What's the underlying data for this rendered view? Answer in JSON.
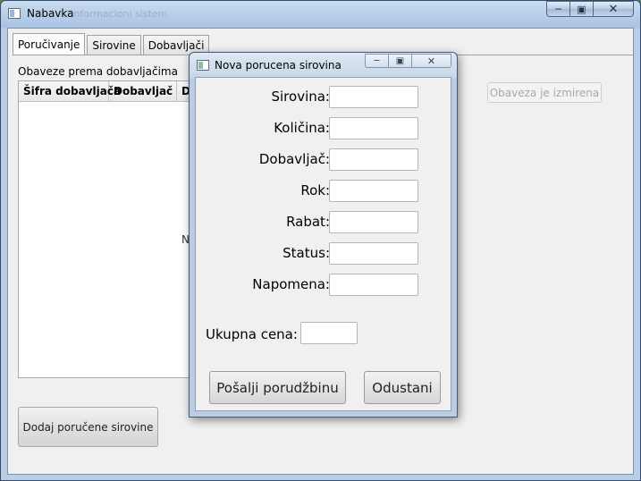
{
  "main_window": {
    "title": "Nabavka",
    "title_ghost": "Informacioni sistem"
  },
  "tabs": [
    {
      "label": "Poručivanje",
      "active": true
    },
    {
      "label": "Sirovine",
      "active": false
    },
    {
      "label": "Dobavljači",
      "active": false
    }
  ],
  "orders_tab": {
    "section_label": "Obaveze prema dobavljačima",
    "table_headers": [
      "Šifra dobavljača",
      "Dobavljač",
      "Da"
    ],
    "table_placeholder": "N",
    "changed_button": "Obaveza je izmirena",
    "add_button": "Dodaj poručene sirovine"
  },
  "dialog": {
    "title": "Nova porucena sirovina",
    "fields": [
      {
        "label": "Sirovina:",
        "value": ""
      },
      {
        "label": "Količina:",
        "value": ""
      },
      {
        "label": "Dobavljač:",
        "value": ""
      },
      {
        "label": "Rok:",
        "value": ""
      },
      {
        "label": "Rabat:",
        "value": ""
      },
      {
        "label": "Status:",
        "value": ""
      },
      {
        "label": "Napomena:",
        "value": ""
      }
    ],
    "total_label": "Ukupna cena:",
    "total_value": "",
    "send_button": "Pošalji porudžbinu",
    "cancel_button": "Odustani"
  },
  "colors": {
    "titlebar": "#b9cfe7",
    "client_bg": "#f0f0f0",
    "disabled_text": "#a8a8a8"
  }
}
